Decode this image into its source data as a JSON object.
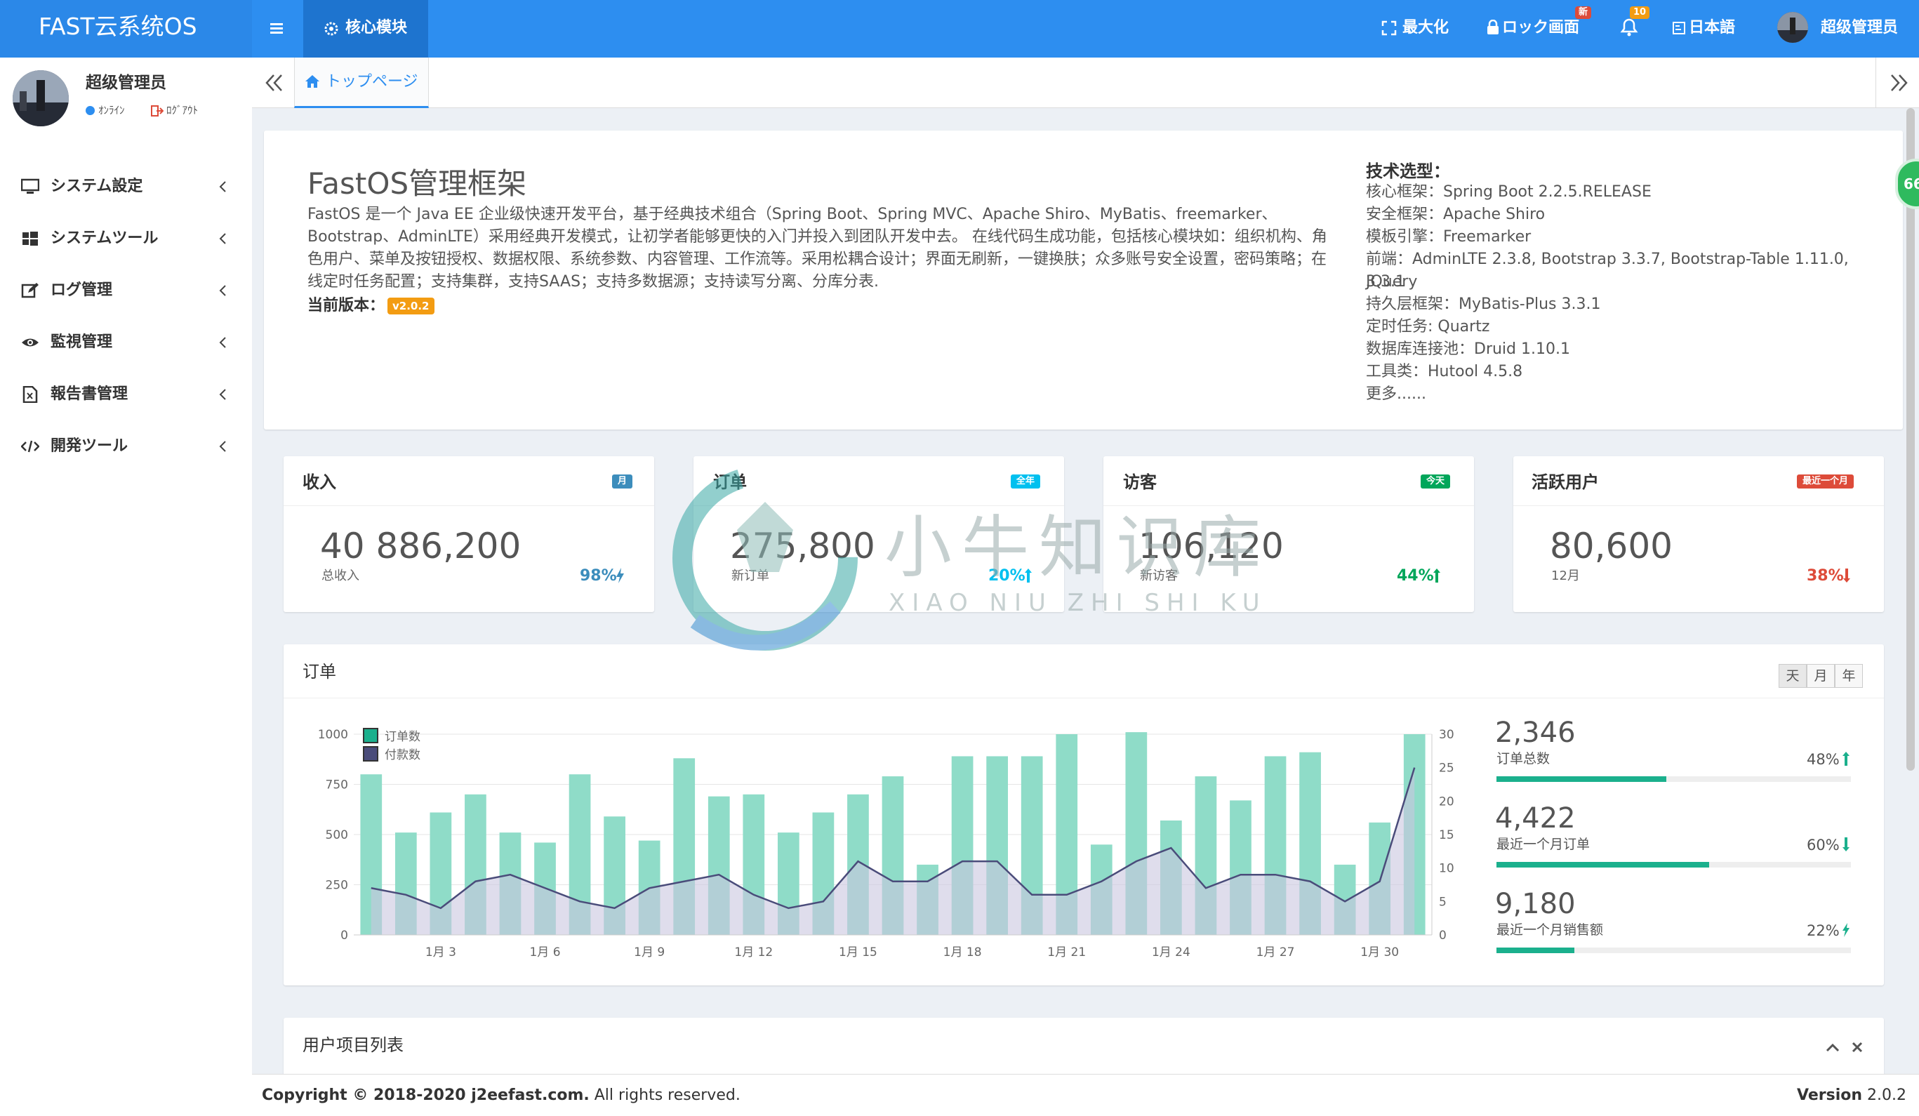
{
  "app": {
    "logo": "FAST云系统OS"
  },
  "topnav": {
    "core_module": "核心模块",
    "maximize": "最大化",
    "lock_screen": "ロック画面",
    "lock_badge": "新",
    "notification_badge": "10",
    "language": "日本語",
    "user": "超级管理员"
  },
  "sidebar": {
    "user": {
      "name": "超级管理员",
      "online": "ｵﾝﾗｲﾝ",
      "logout": "ﾛｸﾞｱｳﾄ"
    },
    "items": [
      {
        "label": "システム設定",
        "icon": "monitor-icon"
      },
      {
        "label": "システムツール",
        "icon": "windows-icon"
      },
      {
        "label": "ログ管理",
        "icon": "edit-icon"
      },
      {
        "label": "監視管理",
        "icon": "eye-icon"
      },
      {
        "label": "報告書管理",
        "icon": "file-excel-icon"
      },
      {
        "label": "開発ツール",
        "icon": "code-icon"
      }
    ]
  },
  "tabs": {
    "home": "トップページ"
  },
  "intro": {
    "title": "FastOS管理框架",
    "text": "FastOS 是一个 Java EE 企业级快速开发平台，基于经典技术组合（Spring Boot、Spring MVC、Apache Shiro、MyBatis、freemarker、Bootstrap、AdminLTE）采用经典开发模式，让初学者能够更快的入门并投入到团队开发中去。 在线代码生成功能，包括核心模块如：组织机构、角色用户、菜单及按钮授权、数据权限、系统参数、内容管理、工作流等。采用松耦合设计；界面无刷新，一键换肤；众多账号安全设置，密码策略；在线定时任务配置；支持集群，支持SAAS；支持多数据源；支持读写分离、分库分表.",
    "version_label": "当前版本：",
    "version": "v2.0.2"
  },
  "tech": {
    "title": "技术选型：",
    "lines": [
      "核心框架：Spring Boot 2.2.5.RELEASE",
      "安全框架：Apache Shiro",
      "模板引擎：Freemarker",
      "前端：AdminLTE 2.3.8, Bootstrap 3.3.7, Bootstrap-Table 1.11.0, JQuery",
      "3.3.1",
      "持久层框架：MyBatis-Plus 3.3.1",
      "定时任务: Quartz",
      "数据库连接池：Druid 1.10.1",
      "工具类：Hutool 4.5.8",
      "更多......"
    ]
  },
  "stats": [
    {
      "title": "收入",
      "label": "月",
      "label_color": "#3c8dbc",
      "value": "40 886,200",
      "sub": "总收入",
      "pct": "98%",
      "pct_color": "#3c8dbc",
      "trend": "bolt"
    },
    {
      "title": "订单",
      "label": "全年",
      "label_color": "#00c0ef",
      "value": "275,800",
      "sub": "新订单",
      "pct": "20%",
      "pct_color": "#00c0ef",
      "trend": "up"
    },
    {
      "title": "访客",
      "label": "今天",
      "label_color": "#00a65a",
      "value": "106,120",
      "sub": "新访客",
      "pct": "44%",
      "pct_color": "#00a65a",
      "trend": "up"
    },
    {
      "title": "活跃用户",
      "label": "最近一个月",
      "label_color": "#dd4b39",
      "value": "80,600",
      "sub": "12月",
      "pct": "38%",
      "pct_color": "#dd4b39",
      "trend": "down"
    }
  ],
  "orders_panel": {
    "title": "订单",
    "seg": [
      "天",
      "月",
      "年"
    ],
    "summary": [
      {
        "value": "2,346",
        "label": "订单总数",
        "pct": "48%",
        "trend": "up",
        "progress": 0.48
      },
      {
        "value": "4,422",
        "label": "最近一个月订单",
        "pct": "60%",
        "trend": "down",
        "progress": 0.6
      },
      {
        "value": "9,180",
        "label": "最近一个月销售额",
        "pct": "22%",
        "trend": "bolt",
        "progress": 0.22
      }
    ]
  },
  "list_panel": {
    "title": "用户项目列表"
  },
  "footer": {
    "copyright_prefix": "Copyright © 2018-2020 ",
    "site": "j2eefast.com.",
    "rights": " All rights reserved.",
    "version_label": "Version",
    "version": "2.0.2"
  },
  "watermark": {
    "text_cn": "小牛知识库",
    "text_en": "XIAO NIU ZHI SHI KU"
  },
  "side_bubble": "66",
  "colors": {
    "primary": "#2d8ef0",
    "bar": "#8fdcc8",
    "line": "#4a4c7a",
    "area": "#c9c7e0",
    "progress": "#1bb08d"
  },
  "chart_data": {
    "type": "bar",
    "x": [
      "1月 1",
      "1月 2",
      "1月 3",
      "1月 4",
      "1月 5",
      "1月 6",
      "1月 7",
      "1月 8",
      "1月 9",
      "1月 10",
      "1月 11",
      "1月 12",
      "1月 13",
      "1月 14",
      "1月 15",
      "1月 16",
      "1月 17",
      "1月 18",
      "1月 19",
      "1月 20",
      "1月 21",
      "1月 22",
      "1月 23",
      "1月 24",
      "1月 25",
      "1月 26",
      "1月 27",
      "1月 28",
      "1月 29",
      "1月 30",
      "1月 31"
    ],
    "xticks": [
      "1月 3",
      "1月 6",
      "1月 9",
      "1月 12",
      "1月 15",
      "1月 18",
      "1月 21",
      "1月 24",
      "1月 27",
      "1月 30"
    ],
    "series": [
      {
        "name": "订单数",
        "axis": "left",
        "kind": "bar",
        "values": [
          800,
          510,
          610,
          700,
          510,
          460,
          800,
          590,
          470,
          880,
          690,
          700,
          510,
          610,
          700,
          790,
          350,
          890,
          890,
          890,
          1000,
          450,
          1010,
          570,
          790,
          670,
          890,
          910,
          350,
          560,
          1000
        ]
      },
      {
        "name": "付款数",
        "axis": "right",
        "kind": "area",
        "values": [
          7,
          6,
          4,
          8,
          9,
          7,
          5,
          4,
          7,
          8,
          9,
          6,
          4,
          5,
          11,
          8,
          8,
          11,
          11,
          6,
          6,
          8,
          11,
          13,
          7,
          9,
          9,
          8,
          5,
          8,
          25
        ]
      }
    ],
    "ylim_left": [
      0,
      1000
    ],
    "yticks_left": [
      0,
      250,
      500,
      750,
      1000
    ],
    "ylim_right": [
      0,
      30
    ],
    "yticks_right": [
      0,
      5,
      10,
      15,
      20,
      25,
      30
    ]
  }
}
